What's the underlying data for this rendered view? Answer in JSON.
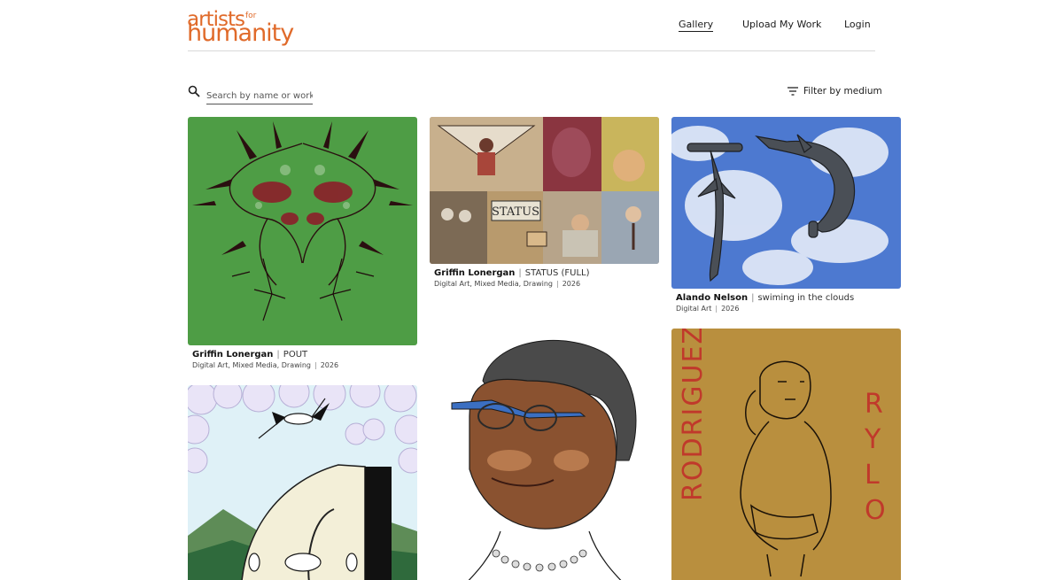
{
  "brand": {
    "logo_line1": "artists",
    "logo_for": "for",
    "logo_line2": "humanity",
    "color": "#e06a2a"
  },
  "nav": {
    "gallery": "Gallery",
    "upload": "Upload My Work",
    "login": "Login"
  },
  "search": {
    "placeholder": "Search by name or work",
    "value": ""
  },
  "filter": {
    "label": "Filter by medium"
  },
  "separator": "|",
  "artworks": [
    {
      "artist": "Griffin Lonergan",
      "title": "POUT",
      "medium": "Digital Art, Mixed Media, Drawing",
      "year": "2026",
      "icon": "symmetric-thorn-art",
      "bg": "#4e9d45"
    },
    {
      "artist": "Griffin Lonergan",
      "title": "STATUS (FULL)",
      "medium": "Digital Art, Mixed Media, Drawing",
      "year": "2026",
      "icon": "collage-art",
      "bg": "#a58e6a"
    },
    {
      "artist": "Alando Nelson",
      "title": "swiming in the clouds",
      "medium": "Digital Art",
      "year": "2026",
      "icon": "hammerhead-sharks-art",
      "bg": "#4d79d0"
    },
    {
      "icon": "cranes-landscape-art",
      "bg": "#f6f4ff"
    },
    {
      "icon": "portrait-woman-glasses-art",
      "bg": "#ffffff"
    },
    {
      "icon": "rodriguez-rylo-sketch-art",
      "bg": "#b98f3e"
    }
  ]
}
